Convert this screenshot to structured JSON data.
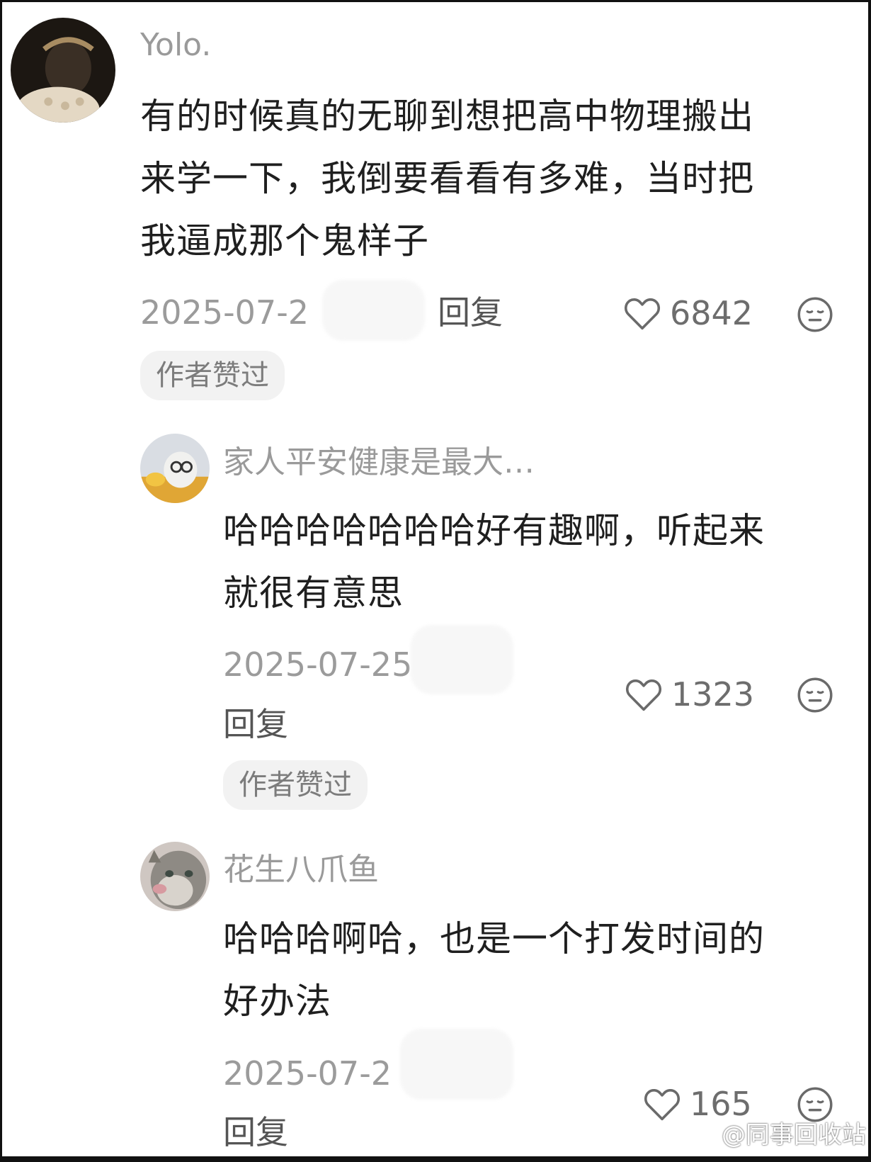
{
  "comments": [
    {
      "username": "Yolo.",
      "text_lines": [
        "有的时候真的无聊到想把高中物理搬出",
        "来学一下，我倒要看看有多难，当时把",
        "我逼成那个鬼样子"
      ],
      "date": "2025-07-2",
      "reply_label": "回复",
      "likes": "6842",
      "badge": "作者赞过",
      "icons": {
        "like": "heart-outline-icon",
        "dislike": "meh-face-icon"
      }
    },
    {
      "username": "家人平安健康是最大…",
      "text_lines": [
        "哈哈哈哈哈哈哈好有趣啊，听起来",
        "就很有意思"
      ],
      "date": "2025-07-25",
      "reply_label": "回复",
      "likes": "1323",
      "badge": "作者赞过",
      "icons": {
        "like": "heart-outline-icon",
        "dislike": "meh-face-icon"
      }
    },
    {
      "username": "花生八爪鱼",
      "text_lines": [
        "哈哈哈啊哈，也是一个打发时间的",
        "好办法"
      ],
      "date": "2025-07-2",
      "reply_label": "回复",
      "likes": "165",
      "icons": {
        "like": "heart-outline-icon",
        "dislike": "meh-face-icon"
      }
    }
  ],
  "watermark": {
    "text": "@同事回收站",
    "icon": "weibo-logo-icon"
  },
  "colors": {
    "username": "#9a9a9a",
    "text": "#1f1f1f",
    "meta": "#9b9b9b",
    "badge_bg": "#f2f2f2"
  }
}
